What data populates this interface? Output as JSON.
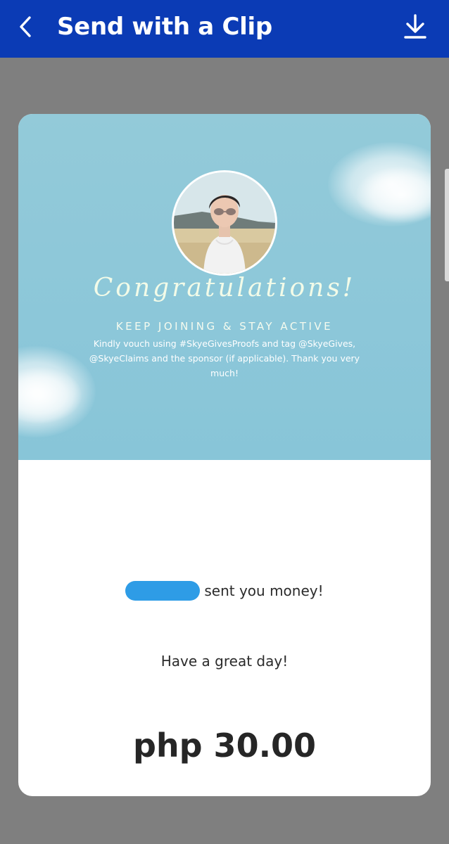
{
  "header": {
    "title": "Send with a Clip",
    "back_icon": "chevron-left-icon",
    "download_icon": "download-icon",
    "background_color": "#0b3bb5"
  },
  "clip": {
    "banner": {
      "headline": "Congratulations!",
      "subheadline": "KEEP JOINING & STAY ACTIVE",
      "message": "Kindly vouch using #SkyeGivesProofs and tag @SkyeGives, @SkyeClaims and the sponsor (if applicable). Thank you very much!"
    },
    "sent_text": "sent you money!",
    "greeting": "Have a great day!",
    "amount": "php 30.00",
    "redaction_color": "#2e9ce6"
  }
}
